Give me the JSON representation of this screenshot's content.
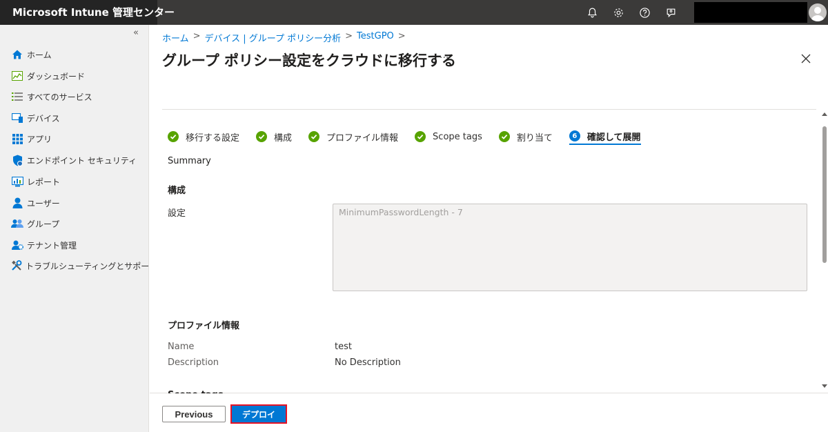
{
  "app": {
    "title": "Microsoft Intune 管理センター"
  },
  "sidebar": {
    "collapse_label": "«",
    "items": [
      {
        "label": "ホーム",
        "icon": "home-icon"
      },
      {
        "label": "ダッシュボード",
        "icon": "dashboard-icon"
      },
      {
        "label": "すべてのサービス",
        "icon": "list-icon"
      },
      {
        "label": "デバイス",
        "icon": "devices-icon"
      },
      {
        "label": "アプリ",
        "icon": "apps-icon"
      },
      {
        "label": "エンドポイント セキュリティ",
        "icon": "shield-icon"
      },
      {
        "label": "レポート",
        "icon": "reports-icon"
      },
      {
        "label": "ユーザー",
        "icon": "user-icon"
      },
      {
        "label": "グループ",
        "icon": "group-icon"
      },
      {
        "label": "テナント管理",
        "icon": "tenant-icon"
      },
      {
        "label": "トラブルシューティングとサポート",
        "icon": "tools-icon"
      }
    ]
  },
  "breadcrumb": [
    "ホーム",
    "デバイス | グループ ポリシー分析",
    "TestGPO"
  ],
  "breadcrumb_sep": ">",
  "page": {
    "title": "グループ ポリシー設定をクラウドに移行する",
    "more": "···"
  },
  "steps": [
    {
      "label": "移行する設定",
      "state": "done"
    },
    {
      "label": "構成",
      "state": "done"
    },
    {
      "label": "プロファイル情報",
      "state": "done"
    },
    {
      "label": "Scope tags",
      "state": "done"
    },
    {
      "label": "割り当て",
      "state": "done"
    },
    {
      "label": "確認して展開",
      "state": "active",
      "number": "6"
    }
  ],
  "summary": {
    "heading": "Summary",
    "config_heading": "構成",
    "settings_label": "設定",
    "settings_value": "MinimumPasswordLength - 7",
    "profile_heading": "プロファイル情報",
    "name_label": "Name",
    "name_value": "test",
    "description_label": "Description",
    "description_value": "No Description",
    "scope_heading": "Scope tags"
  },
  "footer": {
    "previous": "Previous",
    "deploy": "デプロイ"
  },
  "colors": {
    "accent": "#0078d4",
    "success": "#57a300",
    "topbar": "#3b3a39",
    "highlight": "#e81123"
  }
}
